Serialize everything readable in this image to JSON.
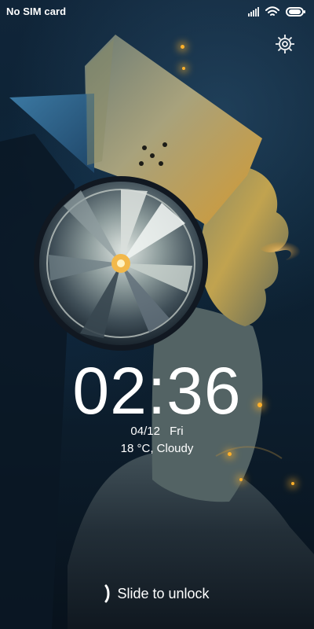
{
  "status_bar": {
    "carrier": "No SIM card",
    "icons": [
      "signal-bars-icon",
      "wifi-icon",
      "battery-icon"
    ]
  },
  "lock_screen": {
    "time": "02:36",
    "date": "04/12",
    "weekday": "Fri",
    "weather": "18 °C, Cloudy",
    "unlock_hint": "Slide to unlock",
    "settings_icon": "gear-icon"
  },
  "colors": {
    "text": "#ffffff",
    "accent_glow": "#ffb12b",
    "background_dark": "#0c2234"
  }
}
